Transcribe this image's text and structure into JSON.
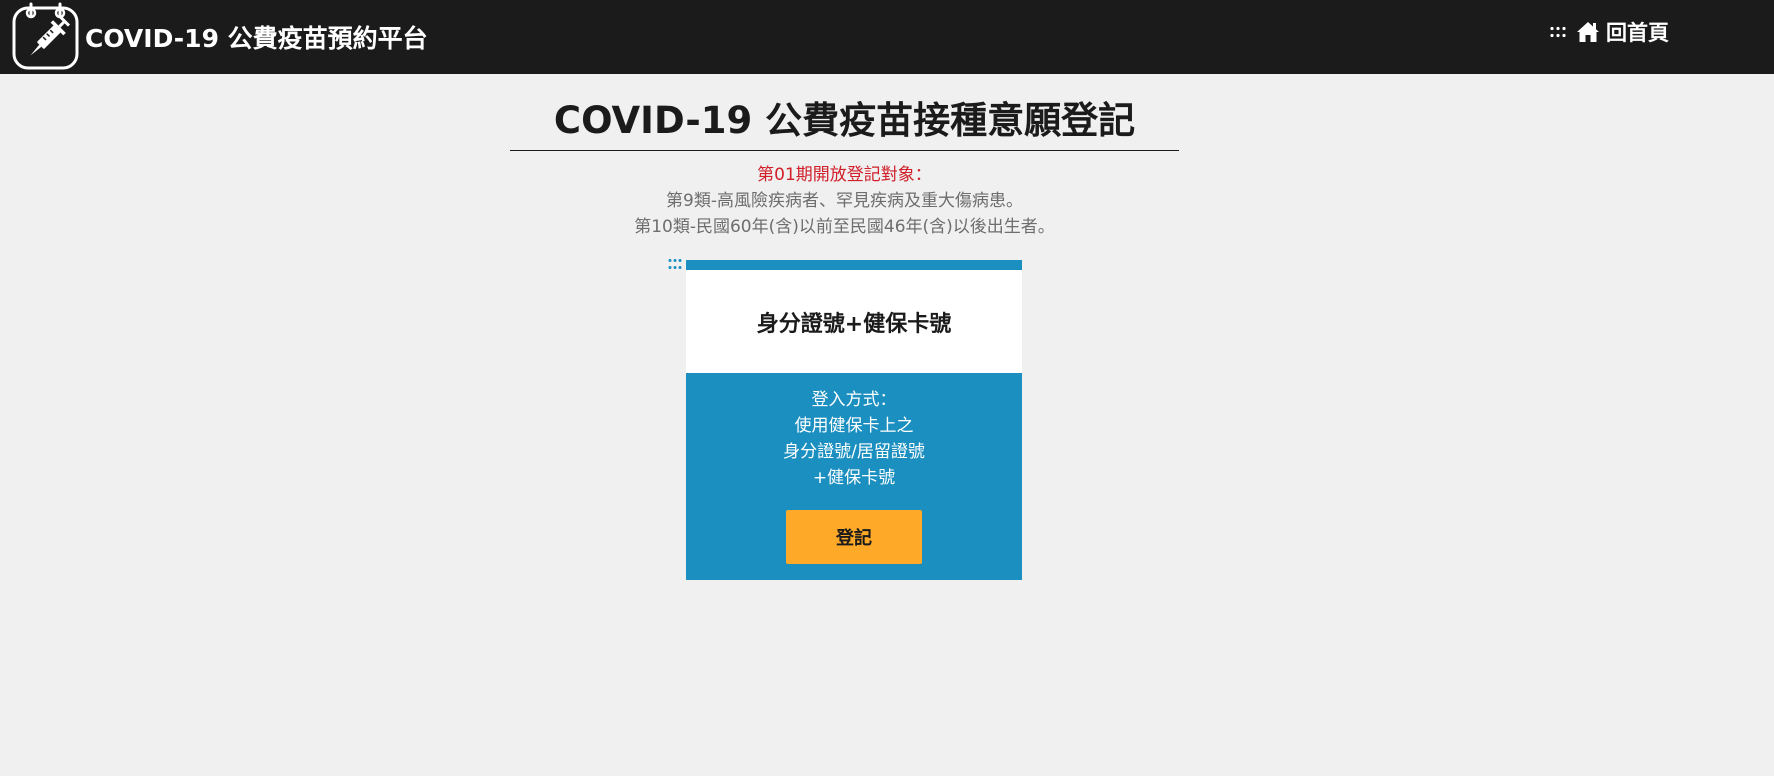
{
  "header": {
    "logo_icon": "vaccine-syringe-calendar-icon",
    "title": "COVID-19 公費疫苗預約平台",
    "menu_icon": "accesskey-dots-icon",
    "home_icon": "home-icon",
    "home_label": "回首頁"
  },
  "main": {
    "title": "COVID-19 公費疫苗接種意願登記",
    "notice": {
      "heading": "第01期開放登記對象：",
      "lines": [
        "第9類-高風險疾病者、罕見疾病及重大傷病患。",
        "第10類-民國60年(含)以前至民國46年(含)以後出生者。"
      ]
    }
  },
  "card": {
    "anchor_icon": "accesskey-dots-icon",
    "title": "身分證號+健保卡號",
    "body_lines": [
      "登入方式：",
      "使用健保卡上之",
      "身分證號/居留證號",
      "+健保卡號"
    ],
    "button_label": "登記"
  },
  "colors": {
    "topbar": "#1b1b1b",
    "page_background": "#f0f0f0",
    "card_blue": "#1a8fc0",
    "button_orange": "#ffa928",
    "notice_red": "#d0202a",
    "notice_gray": "#6e6e6e"
  }
}
